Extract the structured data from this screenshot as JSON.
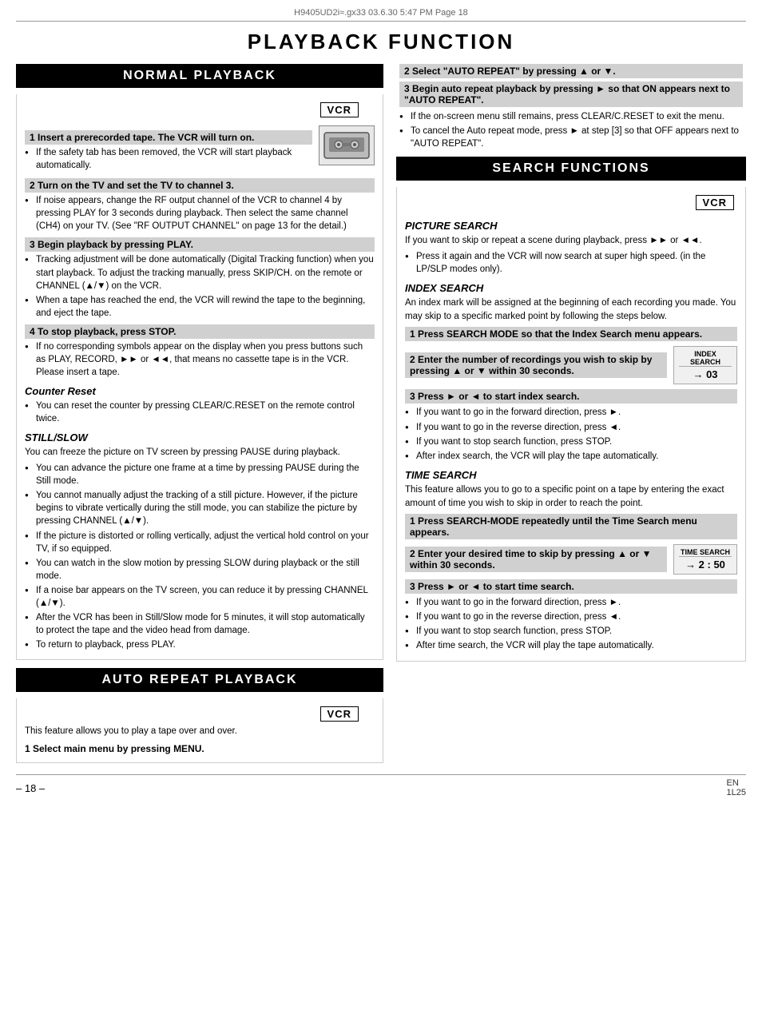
{
  "page": {
    "header": "H9405UD2i≈.gx33   03.6.30 5:47 PM   Page 18",
    "title": "PLAYBACK FUNCTION",
    "footer_page": "– 18 –",
    "footer_code": "EN\n1L25"
  },
  "normal_playback": {
    "section_title": "NORMAL PLAYBACK",
    "vcr_label": "VCR",
    "step1_header": "1   Insert a prerecorded tape. The VCR will turn on.",
    "step1_bullet": "If the safety tab has been removed, the VCR will start playback automatically.",
    "step2_header": "2   Turn on the TV and set the TV to channel 3.",
    "step2_bullet1": "If noise appears, change the RF output channel of the VCR to channel 4 by pressing PLAY for 3 seconds during playback.  Then select the same channel (CH4) on your TV. (See \"RF OUTPUT CHANNEL\" on page 13 for the detail.)",
    "step3_header": "3   Begin playback by pressing PLAY.",
    "step3_bullet1": "Tracking adjustment will be done automatically (Digital Tracking function) when you start playback. To adjust the tracking manually, press SKIP/CH. on the remote or CHANNEL (▲/▼) on the VCR.",
    "step3_bullet2": "When a tape has reached the end, the VCR will rewind the tape to the beginning, and eject the tape.",
    "step4_header": "4   To stop playback, press STOP.",
    "step4_bullet": "If no corresponding symbols appear on the display when you press buttons such as PLAY, RECORD, ►► or ◄◄, that means no cassette tape is in the VCR.  Please insert a tape.",
    "counter_reset_title": "Counter Reset",
    "counter_reset_bullet": "You can reset the counter by pressing CLEAR/C.RESET on the remote control twice.",
    "still_slow_title": "STILL/SLOW",
    "still_slow_body": "You can freeze the picture on TV screen by pressing PAUSE during playback.",
    "still_slow_bullets": [
      "You can advance the picture one frame at a time by pressing PAUSE during the Still mode.",
      "You cannot manually adjust the tracking of a still picture.  However, if the picture begins to vibrate vertically during the still mode, you can stabilize the picture by pressing CHANNEL (▲/▼).",
      "If the picture is distorted or rolling vertically, adjust the vertical hold control on your TV, if so equipped.",
      "You can watch in the slow motion by pressing SLOW during playback or the still mode.",
      "If a noise bar appears on the TV screen, you can reduce it by pressing CHANNEL (▲/▼).",
      "After the VCR has been in Still/Slow mode for 5 minutes, it will stop automatically to protect the tape and the video head from damage.",
      "To return to playback, press PLAY."
    ]
  },
  "auto_repeat": {
    "section_title": "AUTO REPEAT PLAYBACK",
    "vcr_label": "VCR",
    "intro": "This feature allows you to play a tape over and over.",
    "step1_header": "1   Select main menu by pressing MENU.",
    "step2_header": "2   Select \"AUTO REPEAT\" by pressing ▲ or ▼.",
    "step3_header": "3   Begin auto repeat playback by pressing ► so that ON appears next to \"AUTO REPEAT\".",
    "bullet1": "If the on-screen menu still remains, press CLEAR/C.RESET to exit the menu.",
    "bullet2": "To cancel the Auto repeat mode, press ► at step [3] so that OFF appears next to \"AUTO REPEAT\"."
  },
  "search_functions": {
    "section_title": "SEARCH FUNCTIONS",
    "vcr_label": "VCR",
    "picture_search_title": "PICTURE SEARCH",
    "picture_search_body": "If you want to skip or repeat a scene during playback, press ►► or ◄◄.",
    "picture_search_bullet": "Press it again and the VCR will now search at super high speed. (in the LP/SLP modes only).",
    "index_search_title": "INDEX SEARCH",
    "index_search_body": "An index mark will be assigned at the beginning of each recording you made. You may skip to a specific marked point by following the steps below.",
    "index_step1_header": "1   Press SEARCH MODE so that the Index Search menu appears.",
    "index_step2_header": "2   Enter the number of recordings you wish to skip by pressing ▲ or ▼ within 30 seconds.",
    "index_search_box_label": "INDEX SEARCH",
    "index_search_box_value": "→ 03",
    "index_step3_header": "3   Press ► or ◄ to start index search.",
    "index_step3_bullets": [
      "If you want to go in the forward direction, press ►.",
      "If you want to go in the reverse direction, press ◄.",
      "If you want to stop search function, press STOP.",
      "After index search, the VCR will play the tape automatically."
    ],
    "time_search_title": "TIME SEARCH",
    "time_search_body": "This feature allows you to go to a specific point on a tape by entering the exact amount of time you wish to skip in order to reach the point.",
    "time_step1_header": "1   Press SEARCH-MODE repeatedly until the Time Search menu appears.",
    "time_step2_header": "2   Enter your desired time to skip by pressing ▲ or ▼ within 30 seconds.",
    "time_search_box_label": "TIME SEARCH",
    "time_search_box_value": "→ 2 : 50",
    "time_step3_header": "3   Press ► or ◄ to start time search.",
    "time_step3_bullets": [
      "If you want to go in the forward direction, press ►.",
      "If you want to go in the reverse direction, press ◄.",
      "If you want to stop search function, press STOP.",
      "After time search, the VCR will play the tape automatically."
    ]
  }
}
